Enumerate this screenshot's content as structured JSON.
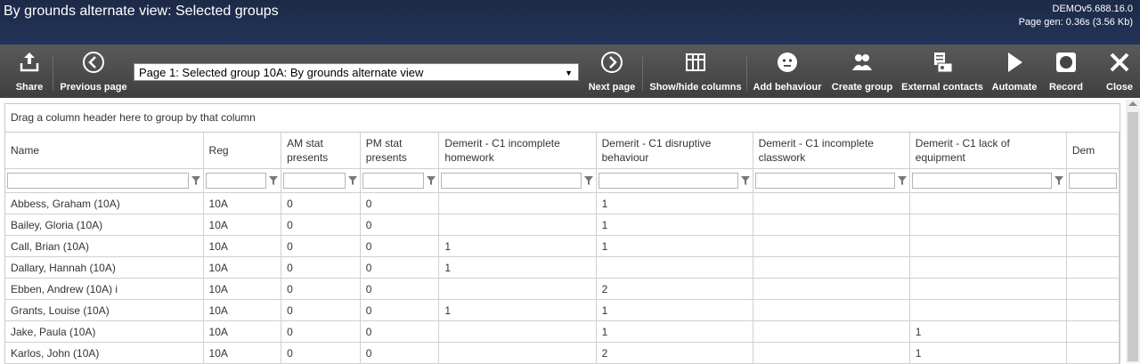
{
  "header": {
    "title": "By grounds alternate view: Selected groups",
    "version": "DEMOv5.688.16.0",
    "page_gen": "Page gen: 0.36s (3.56 Kb)"
  },
  "toolbar": {
    "share": "Share",
    "previous_page": "Previous page",
    "page_select": "Page 1: Selected group 10A: By grounds alternate view",
    "next_page": "Next page",
    "show_hide_columns": "Show/hide columns",
    "add_behaviour": "Add behaviour",
    "create_group": "Create group",
    "external_contacts": "External contacts",
    "automate": "Automate",
    "record": "Record",
    "close": "Close"
  },
  "grid": {
    "group_hint": "Drag a column header here to group by that column",
    "columns": [
      "Name",
      "Reg",
      "AM stat presents",
      "PM stat presents",
      "Demerit - C1 incomplete homework",
      "Demerit - C1 disruptive behaviour",
      "Demerit - C1 incomplete classwork",
      "Demerit - C1 lack of equipment",
      "Dem"
    ],
    "rows": [
      [
        "Abbess, Graham (10A)",
        "10A",
        "0",
        "0",
        "",
        "1",
        "",
        "",
        ""
      ],
      [
        "Bailey, Gloria (10A)",
        "10A",
        "0",
        "0",
        "",
        "1",
        "",
        "",
        ""
      ],
      [
        "Call, Brian (10A)",
        "10A",
        "0",
        "0",
        "1",
        "1",
        "",
        "",
        ""
      ],
      [
        "Dallary, Hannah (10A)",
        "10A",
        "0",
        "0",
        "1",
        "",
        "",
        "",
        ""
      ],
      [
        "Ebben, Andrew (10A) i",
        "10A",
        "0",
        "0",
        "",
        "2",
        "",
        "",
        ""
      ],
      [
        "Grants, Louise (10A)",
        "10A",
        "0",
        "0",
        "1",
        "1",
        "",
        "",
        ""
      ],
      [
        "Jake, Paula (10A)",
        "10A",
        "0",
        "0",
        "",
        "1",
        "",
        "1",
        ""
      ],
      [
        "Karlos, John (10A)",
        "10A",
        "0",
        "0",
        "",
        "2",
        "",
        "1",
        ""
      ]
    ]
  }
}
